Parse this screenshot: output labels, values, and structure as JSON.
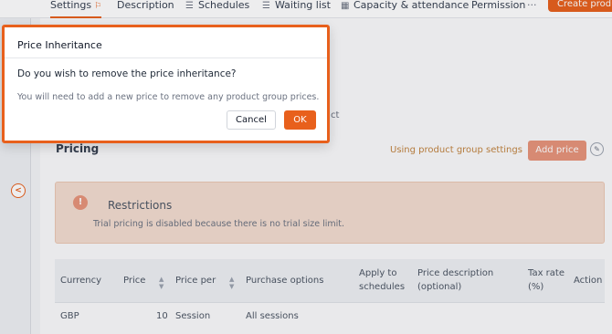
{
  "tabs": [
    {
      "label": "Settings",
      "icon": "warning-icon",
      "active": true
    },
    {
      "label": "Description"
    },
    {
      "label": "Schedules",
      "icon": "list-icon"
    },
    {
      "label": "Waiting list",
      "icon": "list-icon"
    },
    {
      "label": "Capacity & attendance",
      "icon": "calendar-icon"
    },
    {
      "label": "Permission"
    }
  ],
  "more_label": "···",
  "create_button": "Create produc",
  "background_fragment": "ct",
  "pricing": {
    "title": "Pricing",
    "inheritance_label": "Using product group settings",
    "add_price_label": "Add price"
  },
  "restrictions": {
    "icon_glyph": "!",
    "title": "Restrictions",
    "text": "Trial pricing is disabled because there is no trial size limit."
  },
  "table": {
    "headers": [
      {
        "label": "Currency"
      },
      {
        "label": "Price",
        "sortable": true
      },
      {
        "label": "Price per",
        "sortable": true
      },
      {
        "label": "Purchase options"
      },
      {
        "label": "Apply to schedules"
      },
      {
        "label": "Price description (optional)"
      },
      {
        "label": "Tax rate (%)"
      },
      {
        "label": "Action"
      }
    ],
    "rows": [
      {
        "currency": "GBP",
        "price": "10",
        "price_per": "Session",
        "purchase_options": "All sessions"
      }
    ]
  },
  "dialog": {
    "title": "Price Inheritance",
    "question": "Do you wish to remove the price inheritance?",
    "note": "You will need to add a new price to remove any product group prices.",
    "cancel_label": "Cancel",
    "ok_label": "OK"
  },
  "colors": {
    "accent": "#e8601c",
    "restriction_bg": "#f3ddd0",
    "inheritance_text": "#c2843f"
  }
}
